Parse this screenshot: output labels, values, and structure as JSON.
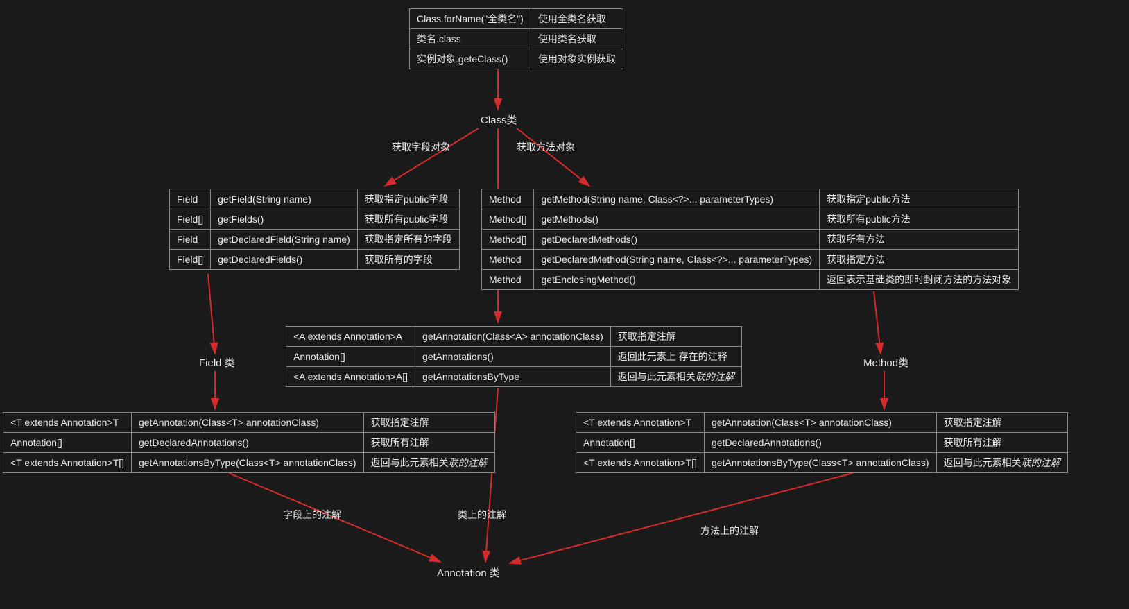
{
  "tables": {
    "top": {
      "rows": [
        {
          "c1": "Class.forName(\"全类名\")",
          "c2": "使用全类名获取"
        },
        {
          "c1": "类名.class",
          "c2": "使用类名获取"
        },
        {
          "c1": "实例对象.geteClass()",
          "c2": "使用对象实例获取"
        }
      ]
    },
    "field": {
      "rows": [
        {
          "c1": "Field",
          "c2": "getField(String name)",
          "c3": "获取指定public字段"
        },
        {
          "c1": "Field[]",
          "c2": "getFields()",
          "c3": "获取所有public字段"
        },
        {
          "c1": "Field",
          "c2": "getDeclaredField(String name)",
          "c3": "获取指定所有的字段"
        },
        {
          "c1": "Field[]",
          "c2": "getDeclaredFields()",
          "c3": "获取所有的字段"
        }
      ]
    },
    "method": {
      "rows": [
        {
          "c1": "Method",
          "c2": "getMethod(String name, Class<?>... parameterTypes)",
          "c3": "获取指定public方法"
        },
        {
          "c1": "Method[]",
          "c2": "getMethods()",
          "c3": "获取所有public方法"
        },
        {
          "c1": "Method[]",
          "c2": "getDeclaredMethods()",
          "c3": "获取所有方法"
        },
        {
          "c1": "Method",
          "c2": "getDeclaredMethod(String name, Class<?>... parameterTypes)",
          "c3": "获取指定方法"
        },
        {
          "c1": "Method",
          "c2": "getEnclosingMethod()",
          "c3": "返回表示基础类的即时封闭方法的方法对象"
        }
      ]
    },
    "classAnno": {
      "rows": [
        {
          "c1": "<A extends Annotation>A",
          "c2": "getAnnotation(Class<A> annotationClass)",
          "c3": "获取指定注解"
        },
        {
          "c1": "Annotation[]",
          "c2": "getAnnotations()",
          "c3": "返回此元素上 存在的注释"
        },
        {
          "c1": "<A extends Annotation>A[]",
          "c2": "getAnnotationsByType",
          "c3": "返回与此元素相关",
          "c3_em": "联的注解"
        }
      ]
    },
    "fieldAnno": {
      "rows": [
        {
          "c1": "<T extends Annotation>T",
          "c2": "getAnnotation(Class<T> annotationClass)",
          "c3": "获取指定注解"
        },
        {
          "c1": "Annotation[]",
          "c2": "getDeclaredAnnotations()",
          "c3": "获取所有注解"
        },
        {
          "c1": "<T extends Annotation>T[]",
          "c2": "getAnnotationsByType(Class<T> annotationClass)",
          "c3": "返回与此元素相关",
          "c3_em": "联的注解"
        }
      ]
    },
    "methodAnno": {
      "rows": [
        {
          "c1": "<T extends Annotation>T",
          "c2": "getAnnotation(Class<T> annotationClass)",
          "c3": "获取指定注解"
        },
        {
          "c1": "Annotation[]",
          "c2": "getDeclaredAnnotations()",
          "c3": "获取所有注解"
        },
        {
          "c1": "<T extends Annotation>T[]",
          "c2": "getAnnotationsByType(Class<T> annotationClass)",
          "c3": "返回与此元素相关",
          "c3_em": "联的注解"
        }
      ]
    }
  },
  "labels": {
    "classNode": "Class类",
    "fieldNode": "Field 类",
    "methodNode": "Method类",
    "annotationNode": "Annotation 类",
    "edgeFieldObj": "获取字段对象",
    "edgeMethodObj": "获取方法对象",
    "edgeFieldAnno": "字段上的注解",
    "edgeClassAnno": "类上的注解",
    "edgeMethodAnno": "方法上的注解"
  },
  "colors": {
    "arrow": "#d52b2b",
    "border": "#888888",
    "bg": "#1a1a1a",
    "text": "#e8e8e8"
  }
}
